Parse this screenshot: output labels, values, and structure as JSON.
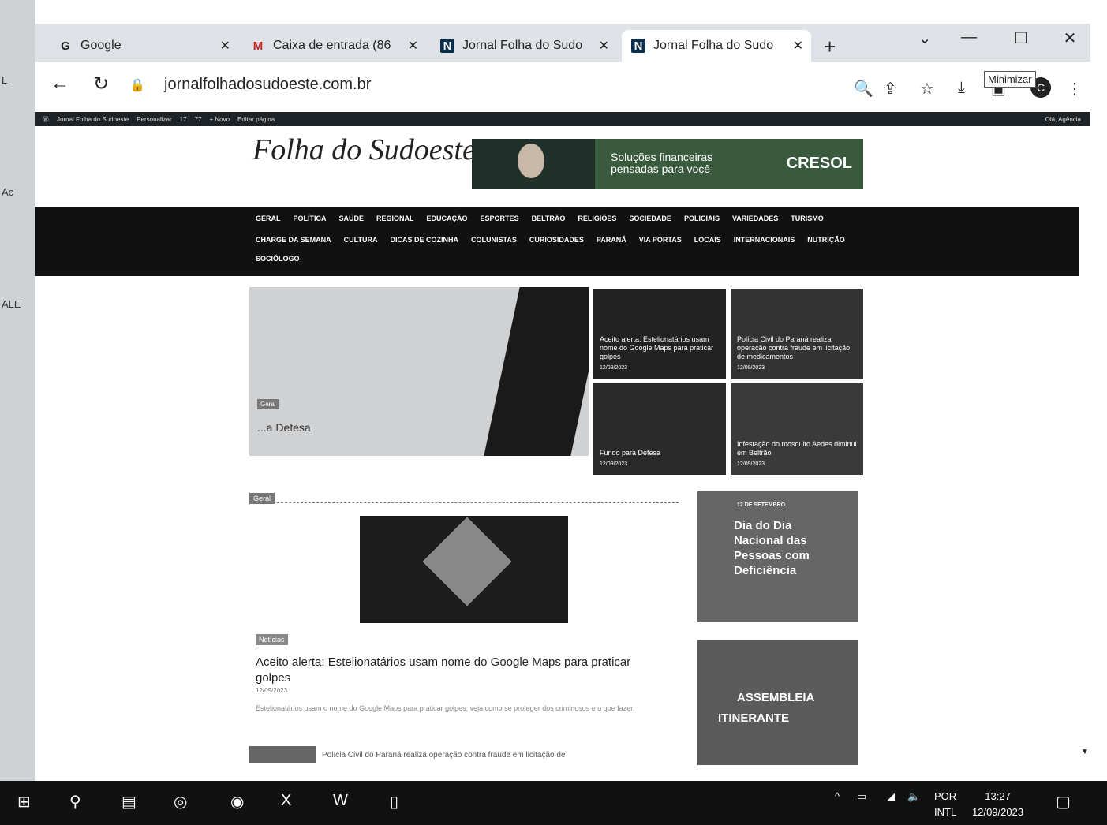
{
  "desktop": {
    "labels": [
      "L",
      "Ac",
      "ALE"
    ]
  },
  "tabs": [
    {
      "label": "Google",
      "icon": "google-icon"
    },
    {
      "label": "Caixa de entrada (86",
      "icon": "gmail-icon"
    },
    {
      "label": "Jornal Folha do Sudo",
      "icon": "site-favicon"
    },
    {
      "label": "Jornal Folha do Sudo",
      "icon": "site-favicon"
    }
  ],
  "tooltip": "Minimizar",
  "address": {
    "url": "jornalfolhadosudoeste.com.br"
  },
  "adminbar": {
    "items": [
      "Jornal Folha do Sudoeste",
      "Personalizar",
      "17",
      "77",
      "+ Novo",
      "Editar página"
    ],
    "right": "Olá, Agência"
  },
  "site": {
    "logo": "Folha do Sudoeste",
    "banner": {
      "text": "Soluções financeiras pensadas para você",
      "brand": "CRESOL"
    }
  },
  "nav": {
    "row1": [
      "GERAL",
      "POLÍTICA",
      "SAÚDE",
      "REGIONAL",
      "EDUCAÇÃO",
      "ESPORTES",
      "BELTRÃO",
      "RELIGIÕES",
      "SOCIEDADE",
      "POLICIAIS",
      "VARIEDADES",
      "TURISMO"
    ],
    "row2": [
      "CHARGE DA SEMANA",
      "CULTURA",
      "DICAS DE COZINHA",
      "COLUNISTAS",
      "CURIOSIDADES",
      "PARANÁ",
      "VIA PORTAS",
      "LOCAIS",
      "INTERNACIONAIS",
      "NUTRIÇÃO"
    ],
    "row3": [
      "SOCIÓLOGO"
    ]
  },
  "featured": {
    "main": {
      "category": "Geral",
      "title": "...a Defesa"
    },
    "side": [
      {
        "title": "Aceito alerta: Estelionatários usam nome do Google Maps para praticar golpes",
        "date": "12/09/2023"
      },
      {
        "title": "Polícia Civil do Paraná realiza operação contra fraude em licitação de medicamentos",
        "date": "12/09/2023"
      },
      {
        "title": "Fundo para Defesa",
        "date": "12/09/2023"
      },
      {
        "title": "Infestação do mosquito Aedes diminui em Beltrão",
        "date": "12/09/2023"
      }
    ]
  },
  "news": {
    "section": "Geral",
    "category": "Notícias",
    "title": "Aceito alerta: Estelionatários usam nome do Google Maps para praticar golpes",
    "meta": "12/09/2023",
    "excerpt": "Estelionatários usam o nome do Google Maps para praticar golpes; veja como se proteger dos criminosos e o que fazer.",
    "second": "Polícia Civil do Paraná realiza operação contra fraude em licitação de"
  },
  "ads": {
    "ad1": {
      "small": "12 DE SETEMBRO",
      "big": "Dia do Dia Nacional das Pessoas com Deficiência"
    },
    "ad2": {
      "line1": "ASSEMBLEIA",
      "line2": "ITINERANTE"
    }
  },
  "taskbar": {
    "lang1": "POR",
    "lang2": "INTL",
    "time": "13:27",
    "date": "12/09/2023"
  }
}
